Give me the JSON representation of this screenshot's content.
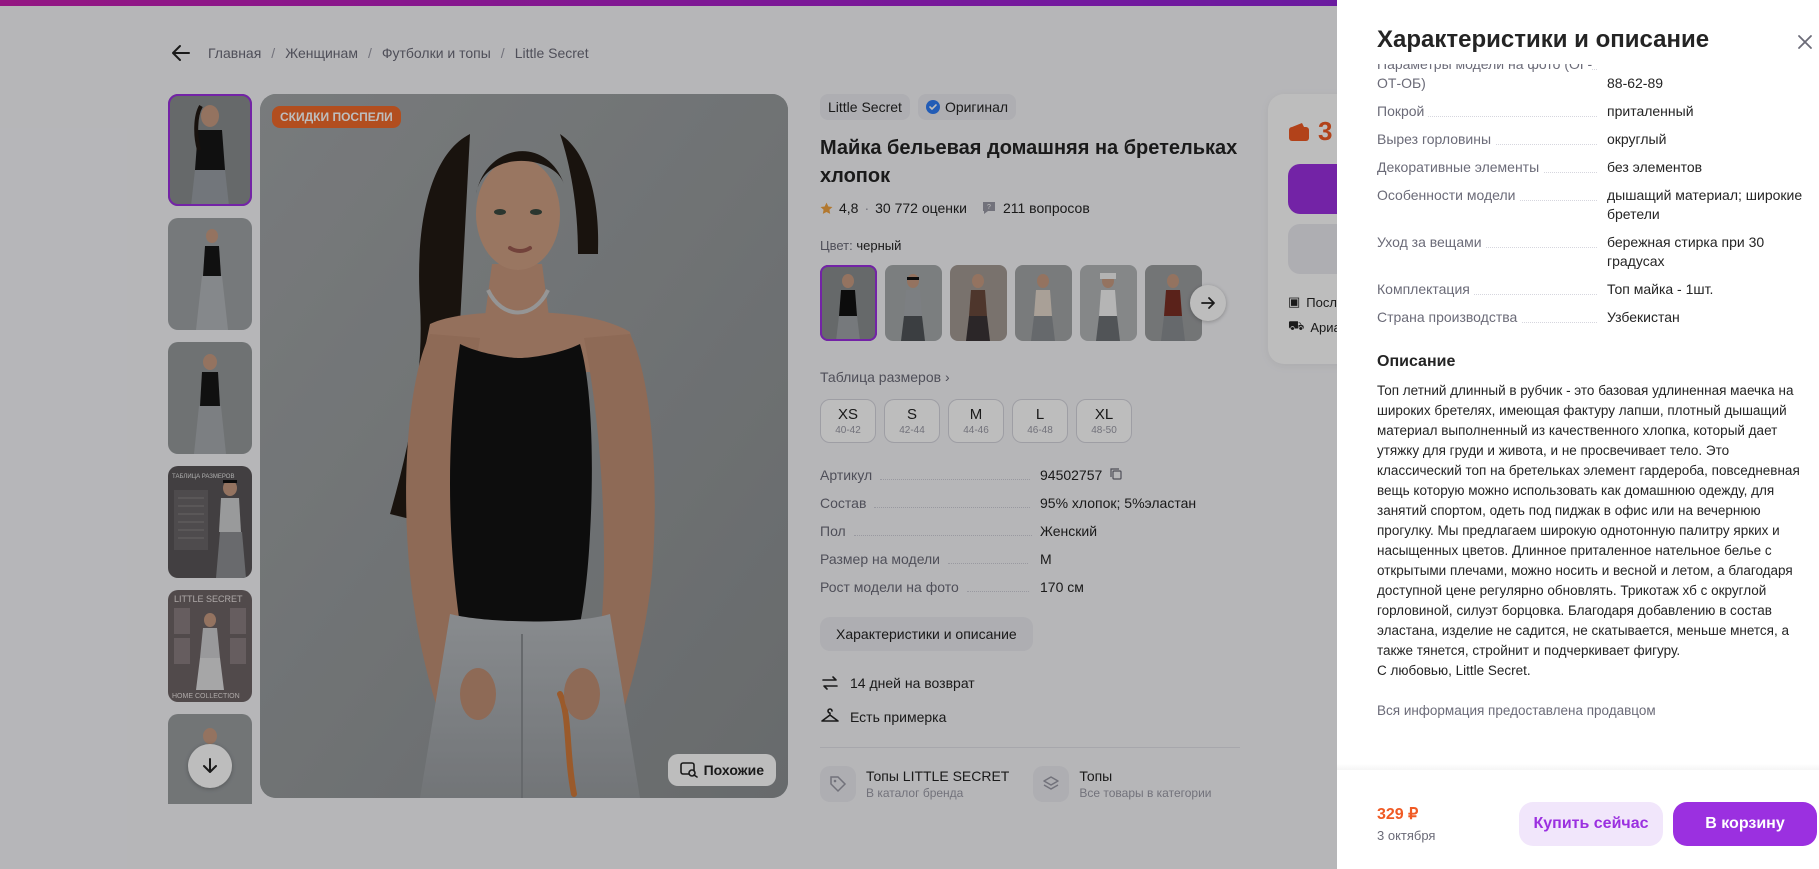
{
  "breadcrumb": {
    "items": [
      "Главная",
      "Женщинам",
      "Футболки и топы",
      "Little Secret"
    ],
    "sep": "/"
  },
  "gallery": {
    "sale_badge": "СКИДКИ ПОСПЕЛИ",
    "similar_label": "Похожие",
    "thumb_caption_4": "ТАБЛИЦА РАЗМЕРОВ",
    "thumb_caption_5_top": "LITTLE SECRET",
    "thumb_caption_5_bottom": "HOME COLLECTION"
  },
  "product": {
    "brand": "Little Secret",
    "original_label": "Оригинал",
    "title": "Майка бельевая домашняя на бретельках хлопок",
    "rating": "4,8",
    "reviews": "30 772 оценки",
    "questions": "211 вопросов",
    "color_label": "Цвет:",
    "color_value": "черный",
    "size_table_label": "Таблица размеров",
    "sizes": [
      {
        "s": "XS",
        "r": "40-42"
      },
      {
        "s": "S",
        "r": "42-44"
      },
      {
        "s": "M",
        "r": "44-46"
      },
      {
        "s": "L",
        "r": "46-48"
      },
      {
        "s": "XL",
        "r": "48-50"
      }
    ],
    "params": [
      {
        "k": "Артикул",
        "v": "94502757"
      },
      {
        "k": "Состав",
        "v": "95% хлопок; 5%эластан"
      },
      {
        "k": "Пол",
        "v": "Женский"
      },
      {
        "k": "Размер на модели",
        "v": "M"
      },
      {
        "k": "Рост модели на фото",
        "v": "170 см"
      }
    ],
    "char_button": "Характеристики и описание",
    "perks": [
      "14 дней на возврат",
      "Есть примерка"
    ],
    "brand_links": [
      {
        "t": "Топы LITTLE SECRET",
        "s": "В каталог бренда"
      },
      {
        "t": "Топы",
        "s": "Все товары в категории"
      }
    ]
  },
  "buycard": {
    "price_partial": "3",
    "row1": "Посл",
    "row2": "Ариа"
  },
  "panel": {
    "title": "Характеристики и описание",
    "rows": [
      {
        "k": "Параметры модели на фото (ОГ-ОТ-ОБ)",
        "v": "88-62-89"
      },
      {
        "k": "Покрой",
        "v": "приталенный"
      },
      {
        "k": "Вырез горловины",
        "v": "округлый"
      },
      {
        "k": "Декоративные элементы",
        "v": "без элементов"
      },
      {
        "k": "Особенности модели",
        "v": "дышащий материал; широкие бретели"
      },
      {
        "k": "Уход за вещами",
        "v": "бережная стирка при 30 градусах"
      },
      {
        "k": "Комплектация",
        "v": "Топ майка - 1шт."
      },
      {
        "k": "Страна производства",
        "v": "Узбекистан"
      }
    ],
    "desc_title": "Описание",
    "description": "Топ летний длинный в рубчик - это базовая удлиненная маечка на широких бретелях, имеющая фактуру лапши, плотный дышащий материал выполненный из качественного хлопка, который дает утяжку для груди и живота, и не просвечивает тело. Это классический топ на бретельках элемент гардероба, повседневная вещь которую можно использовать как домашнюю одежду, для занятий спортом, одеть под пиджак в офис или на вечернюю прогулку. Мы предлагаем широкую однотонную палитру ярких и насыщенных цветов. Длинное приталенное нательное белье с открытыми плечами, можно носить и весной и летом, а благодаря доступной цене регулярно обновлять. Трикотаж хб с округлой горловиной, силуэт борцовка. Благодаря добавлению в состав эластана, изделие не садится, не скатывается, меньше мнется, а также тянется, стройнит и подчеркивает фигуру.",
    "signoff": "С любовью, Little Secret.",
    "seller_note": "Вся информация предоставлена продавцом",
    "price": "329 ₽",
    "date": "3 октября",
    "buy_now": "Купить сейчас",
    "to_cart": "В корзину"
  },
  "colors": {
    "accent": "#9b30e0",
    "price": "#f05a24",
    "sale": "#f06a2a"
  }
}
